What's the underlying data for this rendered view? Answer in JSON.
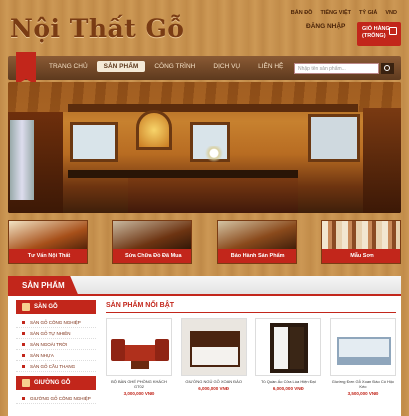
{
  "logo": "Nội Thất Gỗ",
  "toplinks": [
    "BẢN ĐỒ",
    "TIẾNG VIỆT",
    "TỶ GIÁ",
    "VND"
  ],
  "login": "ĐĂNG NHẬP",
  "cart": {
    "line1": "GIỎ HÀNG",
    "line2": "(TRỐNG)"
  },
  "nav": [
    "TRANG CHỦ",
    "SẢN PHẨM",
    "CÔNG TRÌNH",
    "DỊCH VỤ",
    "LIÊN HỆ"
  ],
  "nav_active": 1,
  "search": {
    "placeholder": "Nhập tên sản phẩm..."
  },
  "features": [
    {
      "label": "Tư Vấn Nội Thất"
    },
    {
      "label": "Sửa Chữa Đồ Đã Mua"
    },
    {
      "label": "Bảo Hành Sản Phẩm"
    },
    {
      "label": "Mẫu Sơn"
    }
  ],
  "products_section": {
    "title": "SẢN PHẨM",
    "sidebar": [
      {
        "heading": "SÀN GỖ",
        "items": [
          "SÀN GỖ CÔNG NGHIỆP",
          "SÀN GỖ TỰ NHIÊN",
          "SÀN NGOÀI TRỜI",
          "SÀN NHỰA",
          "SÀN GỖ CẦU THANG"
        ]
      },
      {
        "heading": "GIƯỜNG GỖ",
        "items": [
          "GIƯỜNG GỖ CÔNG NGHIỆP"
        ]
      }
    ],
    "featured_title": "SẢN PHẨM NỔI BẬT",
    "products": [
      {
        "name": "BỘ BÀN GHẾ PHÒNG KHÁCH GT02",
        "price": "3,000,000 VNĐ"
      },
      {
        "name": "GIƯỜNG NGỦ GỖ XOAN ĐÀO",
        "price": "6,000,000 VNĐ"
      },
      {
        "name": "Tủ Quần Áo Cửa Lùa Hiện Đại",
        "price": "6,000,000 VNĐ"
      },
      {
        "name": "Giường Đơn Gỗ Xoan Đào Có Hộc Kéo",
        "price": "3,500,000 VNĐ"
      }
    ]
  }
}
